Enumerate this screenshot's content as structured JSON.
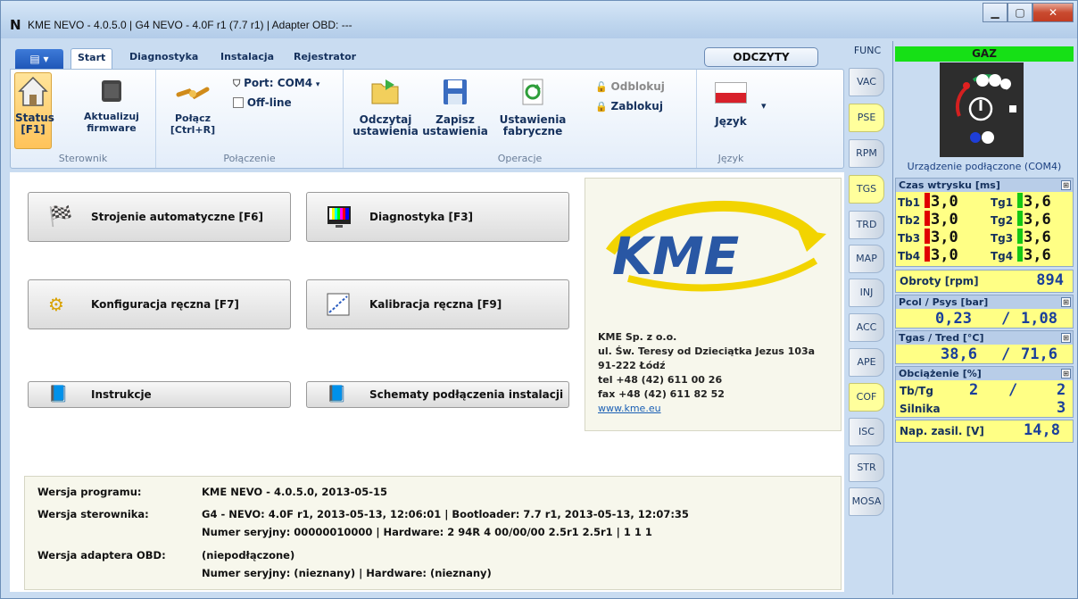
{
  "window": {
    "title": "KME NEVO - 4.0.5.0  |  G4 NEVO - 4.0F r1 (7.7 r1)  |  Adapter OBD: ---",
    "minimize": "▁",
    "maximize": "▢",
    "close": "✕"
  },
  "ribbon": {
    "tabs": [
      {
        "label": "Start"
      },
      {
        "label": "Diagnostyka"
      },
      {
        "label": "Instalacja"
      },
      {
        "label": "Rejestrator"
      }
    ],
    "odczyty": "ODCZYTY",
    "groups": {
      "sterownik": {
        "label": "Sterownik",
        "status": "Status",
        "status_key": "[F1]",
        "firmware_line1": "Aktualizuj",
        "firmware_line2": "firmware"
      },
      "polaczenie": {
        "label": "Połączenie",
        "connect_line1": "Połącz",
        "connect_line2": "[Ctrl+R]",
        "port": "Port: COM4",
        "offline": "Off-line"
      },
      "operacje": {
        "label": "Operacje",
        "read_line1": "Odczytaj",
        "read_line2": "ustawienia",
        "save_line1": "Zapisz",
        "save_line2": "ustawienia",
        "factory_line1": "Ustawienia",
        "factory_line2": "fabryczne",
        "unlock": "Odblokuj",
        "lock": "Zablokuj"
      },
      "jezyk": {
        "label": "Język",
        "language": "Język"
      }
    }
  },
  "main": {
    "buttons": {
      "auto_tune": "Strojenie automatyczne [F6]",
      "diagnostics": "Diagnostyka [F3]",
      "manual_config": "Konfiguracja ręczna [F7]",
      "manual_calib": "Kalibracja ręczna [F9]",
      "instructions": "Instrukcje",
      "schematics": "Schematy podłączenia instalacji"
    },
    "company": {
      "logo": "KME",
      "name": "KME Sp. z o.o.",
      "street": "ul. Św. Teresy od Dzieciątka Jezus 103a",
      "city": "91-222 Łódź",
      "tel": "tel +48 (42) 611 00 26",
      "fax": "fax +48 (42) 611 82 52",
      "www": "www.kme.eu"
    },
    "versions": {
      "program_label": "Wersja programu:",
      "program_value": "KME NEVO - 4.0.5.0, 2013-05-15",
      "controller_label": "Wersja sterownika:",
      "controller_value": "G4 - NEVO: 4.0F r1, 2013-05-13, 12:06:01  |  Bootloader: 7.7 r1, 2013-05-13, 12:07:35",
      "controller_serial": "Numer seryjny: 00000010000  |  Hardware: 2 94R 4 00/00/00  2.5r1 2.5r1  |  1 1 1",
      "obd_label": "Wersja adaptera OBD:",
      "obd_value": "(niepodłączone)",
      "obd_serial": "Numer seryjny: (nieznany)  |  Hardware: (nieznany)"
    }
  },
  "side_tabs": [
    "FUNC",
    "VAC",
    "PSE",
    "RPM",
    "TGS",
    "TRD",
    "MAP",
    "INJ",
    "ACC",
    "APE",
    "COF",
    "ISC",
    "STR",
    "MOSA"
  ],
  "right_panel": {
    "fuel": "GAZ",
    "connection": "Urządzenie podłączone (COM4)",
    "injection": {
      "title": "Czas wtrysku [ms]",
      "rows": [
        {
          "tb": "Tb1",
          "tbv": "3,0",
          "tg": "Tg1",
          "tgv": "3,6"
        },
        {
          "tb": "Tb2",
          "tbv": "3,0",
          "tg": "Tg2",
          "tgv": "3,6"
        },
        {
          "tb": "Tb3",
          "tbv": "3,0",
          "tg": "Tg3",
          "tgv": "3,6"
        },
        {
          "tb": "Tb4",
          "tbv": "3,0",
          "tg": "Tg4",
          "tgv": "3,6"
        }
      ]
    },
    "rpm_label": "Obroty [rpm]",
    "rpm_value": "894",
    "pressure_title": "Pcol / Psys [bar]",
    "pcol": "0,23",
    "psys": "1,08",
    "temp_title": "Tgas / Tred [°C]",
    "tgas": "38,6",
    "tred": "71,6",
    "load_title": "Obciążenie [%]",
    "tbtg_label": "Tb/Tg",
    "tb_load": "2",
    "tg_load": "2",
    "engine_label": "Silnika",
    "engine_load": "3",
    "voltage_label": "Nap. zasil. [V]",
    "voltage_value": "14,8",
    "expand": "⊞",
    "slash": "/"
  },
  "colors": {
    "accent": "#1f57b8",
    "gas": "#16e016",
    "panel": "#ffff85",
    "red": "#e00000"
  }
}
